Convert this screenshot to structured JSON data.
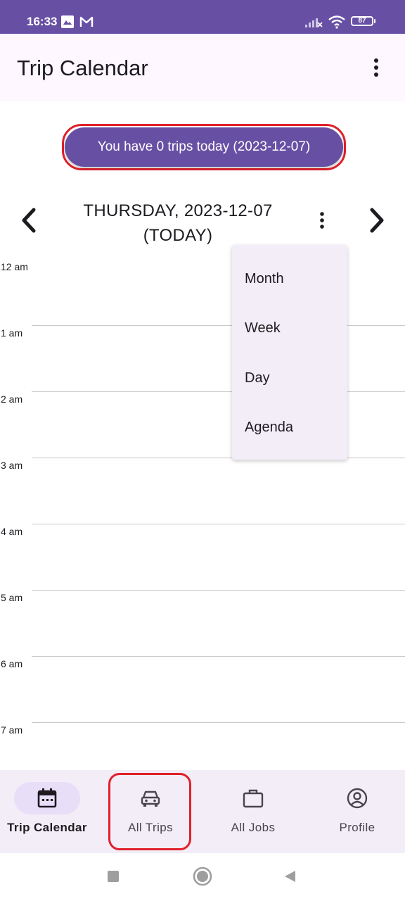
{
  "status_bar": {
    "time": "16:33",
    "battery": "87",
    "icons": [
      "photos-icon",
      "gmail-icon",
      "signal-off-icon",
      "wifi-icon",
      "battery-icon"
    ]
  },
  "app_bar": {
    "title": "Trip Calendar",
    "menu_icon": "more-vert-icon"
  },
  "summary": {
    "text": "You have 0 trips today (2023-12-07)"
  },
  "calendar": {
    "date_title": "THURSDAY, 2023-12-07",
    "today_label": "(TODAY)",
    "hours": [
      "12 am",
      "1 am",
      "2 am",
      "3 am",
      "4 am",
      "5 am",
      "6 am",
      "7 am"
    ]
  },
  "view_menu": {
    "items": [
      "Month",
      "Week",
      "Day",
      "Agenda"
    ]
  },
  "bottom_nav": {
    "items": [
      {
        "label": "Trip Calendar",
        "icon": "calendar-icon",
        "active": true
      },
      {
        "label": "All Trips",
        "icon": "car-icon",
        "active": false
      },
      {
        "label": "All Jobs",
        "icon": "briefcase-icon",
        "active": false
      },
      {
        "label": "Profile",
        "icon": "account-circle-icon",
        "active": false
      }
    ]
  },
  "colors": {
    "primary": "#6750a4",
    "surface": "#fef7ff",
    "nav_surface": "#f3edf7",
    "active_indicator": "#e8def8",
    "highlight_outline": "#e0202a"
  }
}
